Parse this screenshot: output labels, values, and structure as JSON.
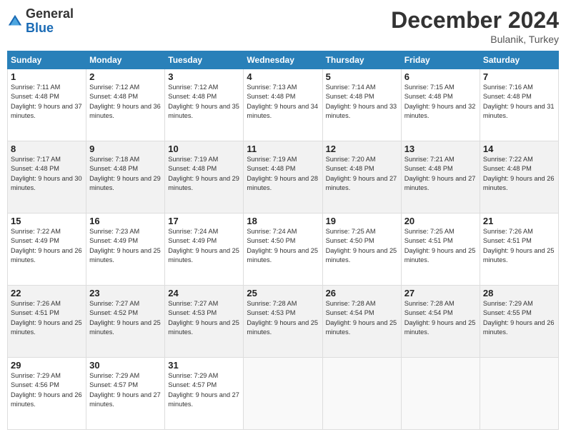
{
  "logo": {
    "general": "General",
    "blue": "Blue"
  },
  "title": "December 2024",
  "location": "Bulanik, Turkey",
  "days_header": [
    "Sunday",
    "Monday",
    "Tuesday",
    "Wednesday",
    "Thursday",
    "Friday",
    "Saturday"
  ],
  "weeks": [
    [
      {
        "day": "1",
        "sunrise": "7:11 AM",
        "sunset": "4:48 PM",
        "daylight": "9 hours and 37 minutes."
      },
      {
        "day": "2",
        "sunrise": "7:12 AM",
        "sunset": "4:48 PM",
        "daylight": "9 hours and 36 minutes."
      },
      {
        "day": "3",
        "sunrise": "7:12 AM",
        "sunset": "4:48 PM",
        "daylight": "9 hours and 35 minutes."
      },
      {
        "day": "4",
        "sunrise": "7:13 AM",
        "sunset": "4:48 PM",
        "daylight": "9 hours and 34 minutes."
      },
      {
        "day": "5",
        "sunrise": "7:14 AM",
        "sunset": "4:48 PM",
        "daylight": "9 hours and 33 minutes."
      },
      {
        "day": "6",
        "sunrise": "7:15 AM",
        "sunset": "4:48 PM",
        "daylight": "9 hours and 32 minutes."
      },
      {
        "day": "7",
        "sunrise": "7:16 AM",
        "sunset": "4:48 PM",
        "daylight": "9 hours and 31 minutes."
      }
    ],
    [
      {
        "day": "8",
        "sunrise": "7:17 AM",
        "sunset": "4:48 PM",
        "daylight": "9 hours and 30 minutes."
      },
      {
        "day": "9",
        "sunrise": "7:18 AM",
        "sunset": "4:48 PM",
        "daylight": "9 hours and 29 minutes."
      },
      {
        "day": "10",
        "sunrise": "7:19 AM",
        "sunset": "4:48 PM",
        "daylight": "9 hours and 29 minutes."
      },
      {
        "day": "11",
        "sunrise": "7:19 AM",
        "sunset": "4:48 PM",
        "daylight": "9 hours and 28 minutes."
      },
      {
        "day": "12",
        "sunrise": "7:20 AM",
        "sunset": "4:48 PM",
        "daylight": "9 hours and 27 minutes."
      },
      {
        "day": "13",
        "sunrise": "7:21 AM",
        "sunset": "4:48 PM",
        "daylight": "9 hours and 27 minutes."
      },
      {
        "day": "14",
        "sunrise": "7:22 AM",
        "sunset": "4:48 PM",
        "daylight": "9 hours and 26 minutes."
      }
    ],
    [
      {
        "day": "15",
        "sunrise": "7:22 AM",
        "sunset": "4:49 PM",
        "daylight": "9 hours and 26 minutes."
      },
      {
        "day": "16",
        "sunrise": "7:23 AM",
        "sunset": "4:49 PM",
        "daylight": "9 hours and 25 minutes."
      },
      {
        "day": "17",
        "sunrise": "7:24 AM",
        "sunset": "4:49 PM",
        "daylight": "9 hours and 25 minutes."
      },
      {
        "day": "18",
        "sunrise": "7:24 AM",
        "sunset": "4:50 PM",
        "daylight": "9 hours and 25 minutes."
      },
      {
        "day": "19",
        "sunrise": "7:25 AM",
        "sunset": "4:50 PM",
        "daylight": "9 hours and 25 minutes."
      },
      {
        "day": "20",
        "sunrise": "7:25 AM",
        "sunset": "4:51 PM",
        "daylight": "9 hours and 25 minutes."
      },
      {
        "day": "21",
        "sunrise": "7:26 AM",
        "sunset": "4:51 PM",
        "daylight": "9 hours and 25 minutes."
      }
    ],
    [
      {
        "day": "22",
        "sunrise": "7:26 AM",
        "sunset": "4:51 PM",
        "daylight": "9 hours and 25 minutes."
      },
      {
        "day": "23",
        "sunrise": "7:27 AM",
        "sunset": "4:52 PM",
        "daylight": "9 hours and 25 minutes."
      },
      {
        "day": "24",
        "sunrise": "7:27 AM",
        "sunset": "4:53 PM",
        "daylight": "9 hours and 25 minutes."
      },
      {
        "day": "25",
        "sunrise": "7:28 AM",
        "sunset": "4:53 PM",
        "daylight": "9 hours and 25 minutes."
      },
      {
        "day": "26",
        "sunrise": "7:28 AM",
        "sunset": "4:54 PM",
        "daylight": "9 hours and 25 minutes."
      },
      {
        "day": "27",
        "sunrise": "7:28 AM",
        "sunset": "4:54 PM",
        "daylight": "9 hours and 25 minutes."
      },
      {
        "day": "28",
        "sunrise": "7:29 AM",
        "sunset": "4:55 PM",
        "daylight": "9 hours and 26 minutes."
      }
    ],
    [
      {
        "day": "29",
        "sunrise": "7:29 AM",
        "sunset": "4:56 PM",
        "daylight": "9 hours and 26 minutes."
      },
      {
        "day": "30",
        "sunrise": "7:29 AM",
        "sunset": "4:57 PM",
        "daylight": "9 hours and 27 minutes."
      },
      {
        "day": "31",
        "sunrise": "7:29 AM",
        "sunset": "4:57 PM",
        "daylight": "9 hours and 27 minutes."
      },
      null,
      null,
      null,
      null
    ]
  ]
}
